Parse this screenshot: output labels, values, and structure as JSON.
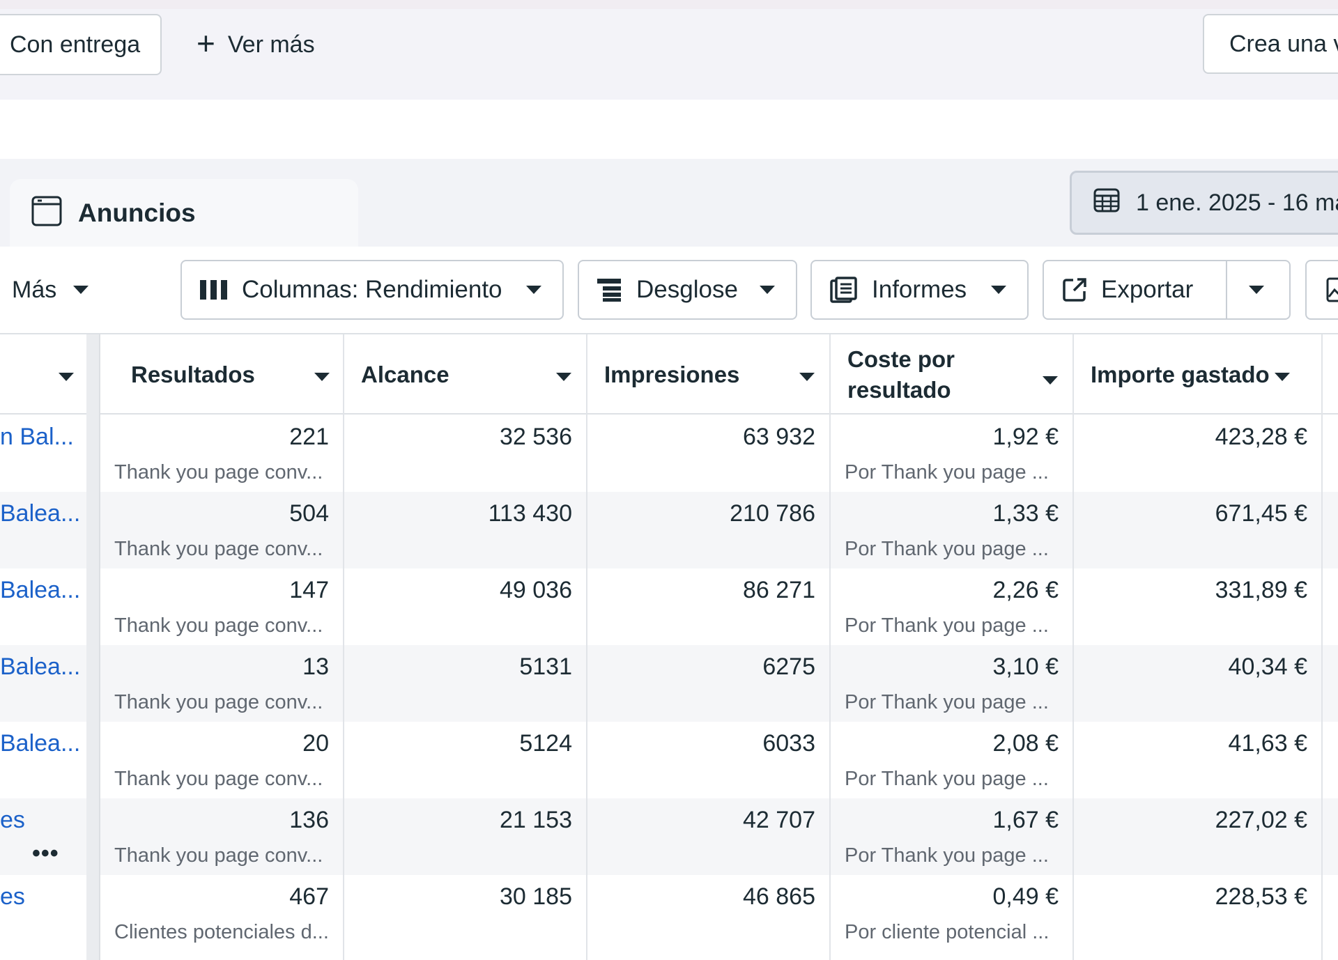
{
  "filters": {
    "delivered_label": "Con entrega",
    "see_more_label": "Ver más",
    "create_view_label": "Crea una v"
  },
  "section": {
    "tab_label": "Anuncios",
    "date_range": "1 ene. 2025 - 16 ma"
  },
  "toolbar": {
    "more_label": "Más",
    "columns_label": "Columnas: Rendimiento",
    "breakdown_label": "Desglose",
    "reports_label": "Informes",
    "export_label": "Exportar"
  },
  "table": {
    "headers": {
      "results": "Resultados",
      "reach": "Alcance",
      "impressions": "Impresiones",
      "cost_line1": "Coste por",
      "cost_line2": "resultado",
      "spent": "Importe gastado"
    },
    "rows": [
      {
        "name": "n Bal...",
        "results": "221",
        "results_sub": "Thank you page conv...",
        "reach": "32 536",
        "impressions": "63 932",
        "cost": "1,92 €",
        "cost_sub": "Por Thank you page ...",
        "spent": "423,28 €"
      },
      {
        "name": "Balea...",
        "results": "504",
        "results_sub": "Thank you page conv...",
        "reach": "113 430",
        "impressions": "210 786",
        "cost": "1,33 €",
        "cost_sub": "Por Thank you page ...",
        "spent": "671,45 €"
      },
      {
        "name": "Balea...",
        "results": "147",
        "results_sub": "Thank you page conv...",
        "reach": "49 036",
        "impressions": "86 271",
        "cost": "2,26 €",
        "cost_sub": "Por Thank you page ...",
        "spent": "331,89 €"
      },
      {
        "name": "Balea...",
        "results": "13",
        "results_sub": "Thank you page conv...",
        "reach": "5131",
        "impressions": "6275",
        "cost": "3,10 €",
        "cost_sub": "Por Thank you page ...",
        "spent": "40,34 €"
      },
      {
        "name": "Balea...",
        "results": "20",
        "results_sub": "Thank you page conv...",
        "reach": "5124",
        "impressions": "6033",
        "cost": "2,08 €",
        "cost_sub": "Por Thank you page ...",
        "spent": "41,63 €"
      },
      {
        "name": "es",
        "results": "136",
        "results_sub": "Thank you page conv...",
        "reach": "21 153",
        "impressions": "42 707",
        "cost": "1,67 €",
        "cost_sub": "Por Thank you page ...",
        "spent": "227,02 €"
      },
      {
        "name": "es",
        "results": "467",
        "results_sub": "Clientes potenciales d...",
        "reach": "30 185",
        "impressions": "46 865",
        "cost": "0,49 €",
        "cost_sub": "Por cliente potencial ...",
        "spent": "228,53 €"
      }
    ],
    "row_more_glyph": "•••"
  }
}
